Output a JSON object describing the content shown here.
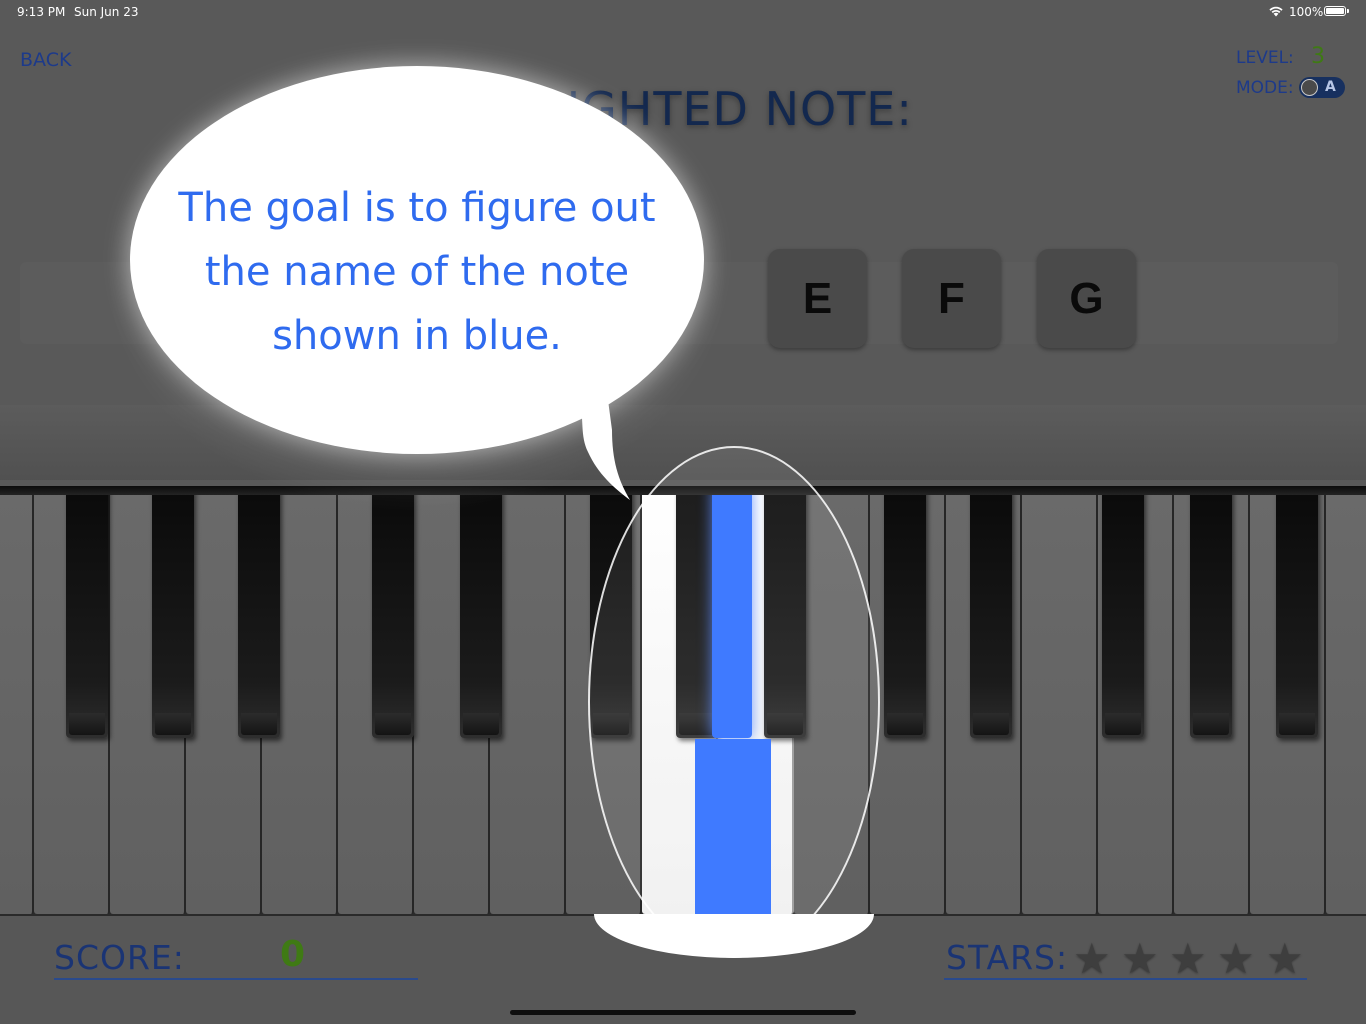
{
  "status_bar": {
    "time": "9:13 PM",
    "date": "Sun Jun 23",
    "battery": "100%"
  },
  "header": {
    "back_label": "BACK",
    "level_label": "LEVEL:",
    "level_value": "3",
    "mode_label": "MODE:",
    "mode_value": "A"
  },
  "prompt": "IGHLIGHTED NOTE:",
  "note_buttons": [
    "E",
    "F",
    "G"
  ],
  "tutorial": {
    "lines": [
      "The goal is to figure out",
      "the name of the note",
      "shown in blue."
    ]
  },
  "footer": {
    "score_label": "SCORE:",
    "score_value": "0",
    "stars_label": "STARS:",
    "stars_earned": 0,
    "stars_total": 5
  },
  "colors": {
    "highlight_key": "#2f6fff",
    "label_text": "#1a3474",
    "value_green": "#3f7a14",
    "bubble_text": "#2f6bef"
  }
}
